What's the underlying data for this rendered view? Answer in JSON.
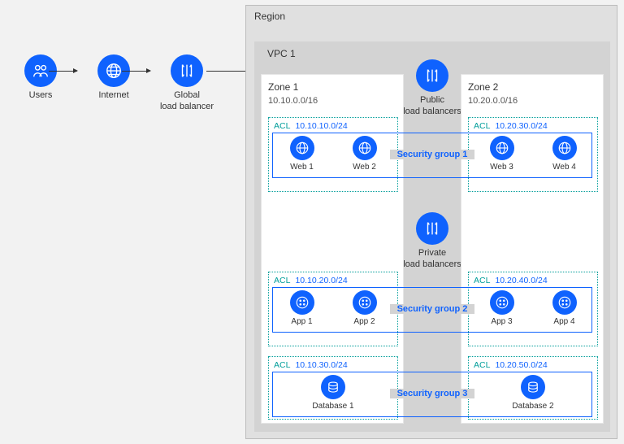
{
  "outside": {
    "users": "Users",
    "internet": "Internet",
    "glb": "Global\nload balancer"
  },
  "region": {
    "label": "Region"
  },
  "vpc": {
    "label": "VPC 1"
  },
  "public_lb": "Public\nload balancers",
  "private_lb": "Private\nload balancers",
  "zone1": {
    "title": "Zone 1",
    "cidr": "10.10.0.0/16"
  },
  "zone2": {
    "title": "Zone 2",
    "cidr": "10.20.0.0/16"
  },
  "acl_label": "ACL",
  "z1": {
    "acl1": "10.10.10.0/24",
    "web1": "Web 1",
    "web2": "Web 2",
    "acl2": "10.10.20.0/24",
    "app1": "App 1",
    "app2": "App 2",
    "acl3": "10.10.30.0/24",
    "db": "Database 1"
  },
  "z2": {
    "acl1": "10.20.30.0/24",
    "web3": "Web 3",
    "web4": "Web 4",
    "acl2": "10.20.40.0/24",
    "app3": "App 3",
    "app4": "App 4",
    "acl3": "10.20.50.0/24",
    "db": "Database 2"
  },
  "sg": {
    "g1": "Security group 1",
    "g2": "Security group 2",
    "g3": "Security group 3"
  }
}
